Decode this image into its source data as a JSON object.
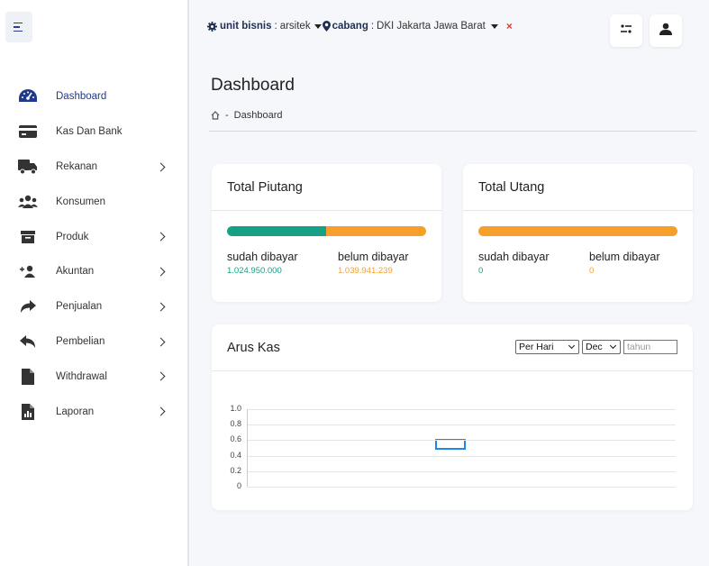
{
  "sidebar": {
    "items": [
      {
        "label": "Dashboard",
        "icon": "tachometer-icon",
        "chevron": false,
        "active": true
      },
      {
        "label": "Kas Dan Bank",
        "icon": "credit-card-icon",
        "chevron": false
      },
      {
        "label": "Rekanan",
        "icon": "truck-icon",
        "chevron": true
      },
      {
        "label": "Konsumen",
        "icon": "users-icon",
        "chevron": false
      },
      {
        "label": "Produk",
        "icon": "archive-icon",
        "chevron": true
      },
      {
        "label": "Akuntan",
        "icon": "user-plus-icon",
        "chevron": true
      },
      {
        "label": "Penjualan",
        "icon": "share-icon",
        "chevron": true
      },
      {
        "label": "Pembelian",
        "icon": "reply-icon",
        "chevron": true
      },
      {
        "label": "Withdrawal",
        "icon": "file-icon",
        "chevron": true
      },
      {
        "label": "Laporan",
        "icon": "file-chart-icon",
        "chevron": true
      }
    ]
  },
  "topbar": {
    "unit_label": "unit bisnis",
    "unit_value": "arsitek",
    "cabang_label": "cabang",
    "cabang_value": "DKI Jakarta Jawa Barat",
    "separator": ":",
    "close_symbol": "×"
  },
  "page": {
    "title": "Dashboard",
    "breadcrumb_sep": "-",
    "breadcrumb_current": "Dashboard"
  },
  "piutang": {
    "title": "Total Piutang",
    "paid_label": "sudah dibayar",
    "paid_value": "1.024.950.000",
    "unpaid_label": "belum dibayar",
    "unpaid_value": "1.039.941.239",
    "paid_fraction": 0.4964
  },
  "utang": {
    "title": "Total Utang",
    "paid_label": "sudah dibayar",
    "paid_value": "0",
    "unpaid_label": "belum dibayar",
    "unpaid_value": "0",
    "paid_fraction": 0
  },
  "arus_kas": {
    "title": "Arus Kas",
    "period_selected": "Per Hari",
    "month_selected": "Dec",
    "year_placeholder": "tahun"
  },
  "chart_data": {
    "type": "line",
    "title": "",
    "series": [
      {
        "values": [],
        "color": "#1e88e5"
      }
    ],
    "ylim": [
      0,
      1.0
    ],
    "yticks": [
      "1.0",
      "0.8",
      "0.6",
      "0.4",
      "0.2",
      "0"
    ],
    "grid": true
  },
  "colors": {
    "paid": "#16a085",
    "unpaid": "#f6a02b",
    "accent": "#1e3a8a"
  }
}
